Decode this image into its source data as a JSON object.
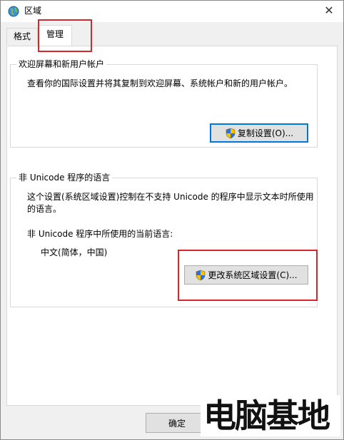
{
  "window": {
    "title": "区域",
    "close_glyph": "✕"
  },
  "tabs": [
    {
      "label": "格式",
      "selected": false
    },
    {
      "label": "管理",
      "selected": true
    }
  ],
  "welcome_group": {
    "legend": "欢迎屏幕和新用户帐户",
    "description": "查看你的国际设置并将其复制到欢迎屏幕、系统帐户和新的用户帐户。",
    "copy_button": "复制设置(O)..."
  },
  "unicode_group": {
    "legend": "非 Unicode 程序的语言",
    "description": "这个设置(系统区域设置)控制在不支持 Unicode 的程序中显示文本时所使用的语言。",
    "current_label": "非 Unicode 程序中所使用的当前语言:",
    "current_value": "中文(简体，中国)",
    "change_button": "更改系统区域设置(C)..."
  },
  "footer": {
    "ok_button": "确定"
  },
  "watermark": "电脑基地",
  "colors": {
    "highlight": "#d9262b",
    "focus": "#0078d7"
  },
  "icons": {
    "app": "globe-icon",
    "button": "uac-shield-icon"
  }
}
